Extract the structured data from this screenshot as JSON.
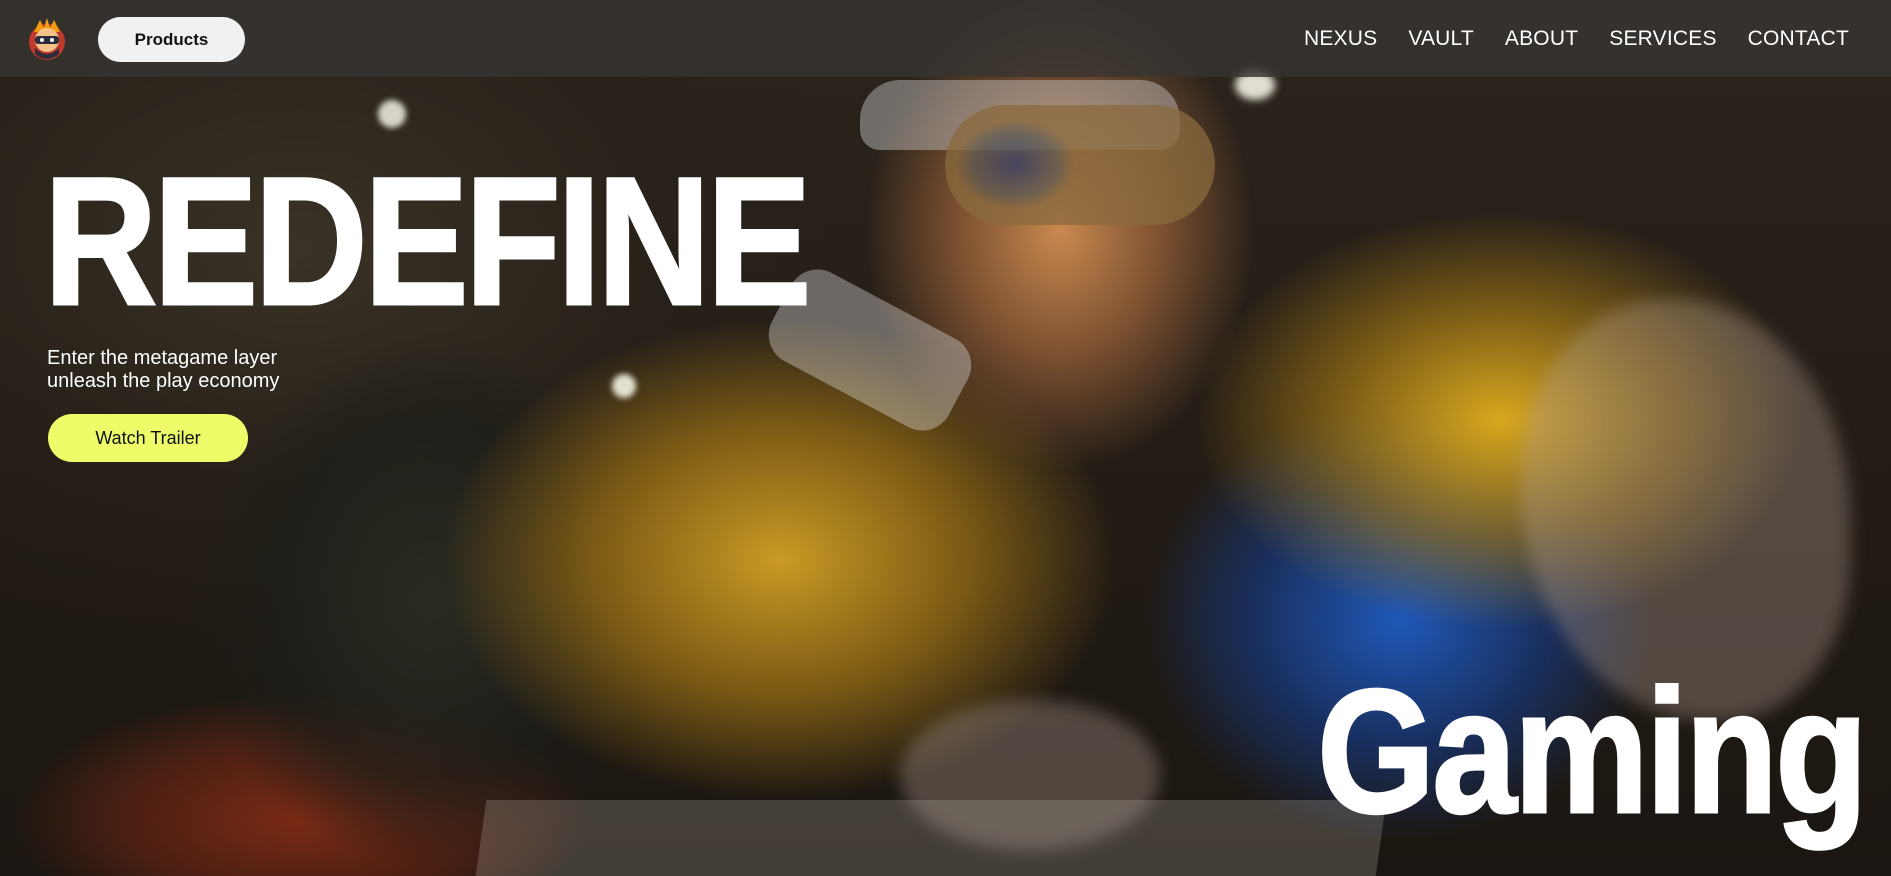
{
  "header": {
    "logo_icon": "ninja-mascot-icon",
    "products_label": "Products",
    "nav": [
      {
        "label": "NEXUS"
      },
      {
        "label": "VAULT"
      },
      {
        "label": "ABOUT"
      },
      {
        "label": "SERVICES"
      },
      {
        "label": "CONTACT"
      }
    ]
  },
  "hero": {
    "headline": "REDEFINE",
    "tagline_line1": "Enter the metagame layer",
    "tagline_line2": "unleash the play economy",
    "cta_label": "Watch Trailer",
    "bottom_word": "Gaming",
    "background_icon": "hero-character-artwork"
  },
  "colors": {
    "cta_background": "#eefc6a",
    "navbar_background": "#373432",
    "text": "#ffffff"
  }
}
